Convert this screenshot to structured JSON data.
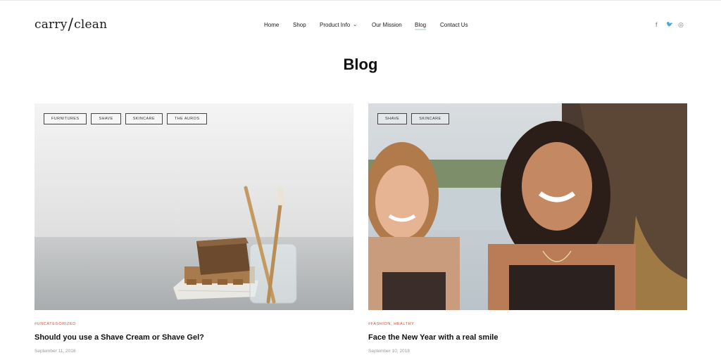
{
  "brand": {
    "logo_left": "carry",
    "logo_slash": "/",
    "logo_right": "clean"
  },
  "nav": {
    "items": [
      {
        "label": "Home"
      },
      {
        "label": "Shop"
      },
      {
        "label": "Product Info",
        "has_dropdown": true,
        "chevron": "⌄"
      },
      {
        "label": "Our Mission"
      },
      {
        "label": "Blog",
        "active": true
      },
      {
        "label": "Contact Us"
      }
    ]
  },
  "social": [
    {
      "icon": "facebook-icon",
      "glyph": "f"
    },
    {
      "icon": "twitter-icon",
      "glyph": "🐦"
    },
    {
      "icon": "instagram-icon",
      "glyph": "◎"
    }
  ],
  "page": {
    "title": "Blog"
  },
  "posts": [
    {
      "tags": [
        "FURNITURES",
        "SHAVE",
        "SKINCARE",
        "THE AUROS"
      ],
      "category": "#UNCATEGORIZED",
      "title": "Should you use a Shave Cream or Shave Gel?",
      "date": "September 11, 2018"
    },
    {
      "tags": [
        "SHAVE",
        "SKINCARE"
      ],
      "category": "#FASHION, HEALTHY",
      "title": "Face the New Year with a real smile",
      "date": "September 10, 2018"
    }
  ],
  "colors": {
    "accent": "#c4553b",
    "active_underline": "#cfe5e2",
    "text": "#111111",
    "muted": "#9a9a9a"
  }
}
